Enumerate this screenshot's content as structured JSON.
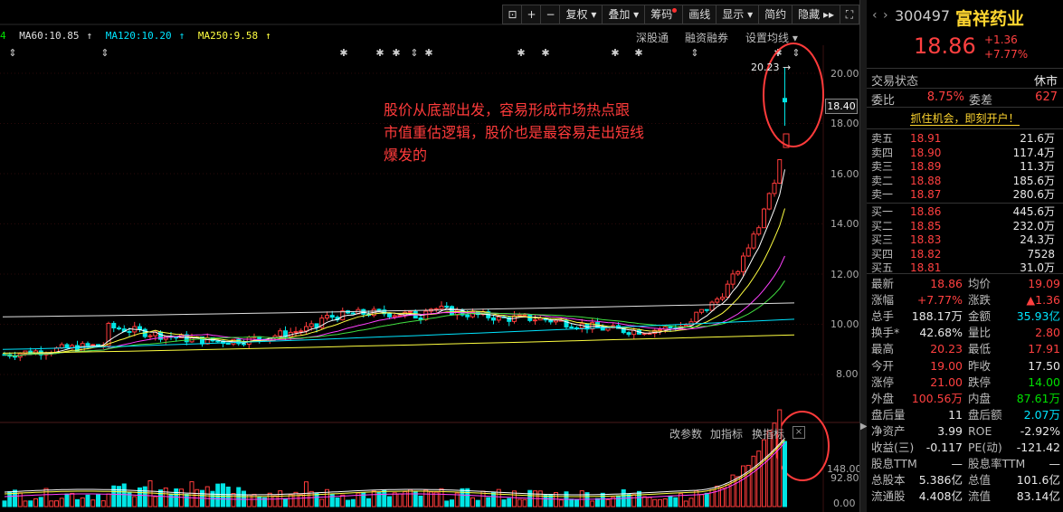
{
  "toolbar": {
    "buttons": [
      "复权",
      "叠加",
      "筹码",
      "画线",
      "显示",
      "简约",
      "隐藏"
    ],
    "icons": [
      "lock-icon",
      "plus-icon",
      "minus-icon"
    ],
    "chip_dot_color": "#ff3030"
  },
  "ma_bar": {
    "items": [
      {
        "label": "4",
        "color": "#00e000"
      },
      {
        "label": "MA60:10.85",
        "color": "#e0e0e0"
      },
      {
        "label": "MA120:10.20",
        "color": "#00e5ff"
      },
      {
        "label": "MA250:9.58",
        "color": "#ffff40"
      }
    ],
    "tools": [
      "深股通",
      "融资融券",
      "设置均线"
    ]
  },
  "annotation": {
    "lines": [
      "股价从底部出发，容易形成市场热点跟",
      "市值重估逻辑，股价也是最容易走出短线",
      "爆发的"
    ]
  },
  "price_axis": {
    "ticks": [
      "20.00",
      "18.00",
      "16.00",
      "14.00",
      "12.00",
      "10.00",
      "8.00"
    ],
    "current": "18.40",
    "high_marker": "20.23"
  },
  "indicator": {
    "tools": [
      "改参数",
      "加指标",
      "换指标"
    ],
    "ticks": [
      "148.00",
      "92.80",
      "0.00"
    ]
  },
  "chart_data": {
    "type": "candlestick",
    "ylim": [
      7,
      21
    ],
    "highlight_last": {
      "open": 19.0,
      "high": 20.23,
      "low": 17.91,
      "close": 18.86
    },
    "ma_lines": [
      {
        "name": "MA60",
        "value": 10.85,
        "color": "#e0e0e0"
      },
      {
        "name": "MA120",
        "value": 10.2,
        "color": "#00e5ff"
      },
      {
        "name": "MA250",
        "value": 9.58,
        "color": "#ffff40"
      }
    ]
  },
  "quote": {
    "code": "300497",
    "name": "富祥药业",
    "price": "18.86",
    "change": "+1.36",
    "pct": "+7.77%",
    "status_label": "交易状态",
    "status": "休市",
    "weibi_label": "委比",
    "weibi": "8.75%",
    "weicha_label": "委差",
    "weicha": "627",
    "promo": "抓住机会，即刻开户！"
  },
  "order_book": {
    "asks": [
      {
        "label": "卖五",
        "price": "18.91",
        "vol": "21.6万"
      },
      {
        "label": "卖四",
        "price": "18.90",
        "vol": "117.4万"
      },
      {
        "label": "卖三",
        "price": "18.89",
        "vol": "11.3万"
      },
      {
        "label": "卖二",
        "price": "18.88",
        "vol": "185.6万"
      },
      {
        "label": "卖一",
        "price": "18.87",
        "vol": "280.6万"
      }
    ],
    "bids": [
      {
        "label": "买一",
        "price": "18.86",
        "vol": "445.6万"
      },
      {
        "label": "买二",
        "price": "18.85",
        "vol": "232.0万"
      },
      {
        "label": "买三",
        "price": "18.83",
        "vol": "24.3万"
      },
      {
        "label": "买四",
        "price": "18.82",
        "vol": "7528"
      },
      {
        "label": "买五",
        "price": "18.81",
        "vol": "31.0万"
      }
    ]
  },
  "stats": [
    {
      "l1": "最新",
      "v1": "18.86",
      "c1": "red",
      "l2": "均价",
      "v2": "19.09",
      "c2": "red"
    },
    {
      "l1": "涨幅",
      "v1": "+7.77%",
      "c1": "red",
      "l2": "涨跌",
      "v2": "▲1.36",
      "c2": "red"
    },
    {
      "l1": "总手",
      "v1": "188.17万",
      "c1": "white",
      "l2": "金额",
      "v2": "35.93亿",
      "c2": "cyan"
    },
    {
      "l1": "换手*",
      "v1": "42.68%",
      "c1": "white",
      "l2": "量比",
      "v2": "2.80",
      "c2": "red"
    },
    {
      "l1": "最高",
      "v1": "20.23",
      "c1": "red",
      "l2": "最低",
      "v2": "17.91",
      "c2": "red"
    },
    {
      "l1": "今开",
      "v1": "19.00",
      "c1": "red",
      "l2": "昨收",
      "v2": "17.50",
      "c2": "white"
    },
    {
      "l1": "涨停",
      "v1": "21.00",
      "c1": "red",
      "l2": "跌停",
      "v2": "14.00",
      "c2": "green"
    },
    {
      "l1": "外盘",
      "v1": "100.56万",
      "c1": "red",
      "l2": "内盘",
      "v2": "87.61万",
      "c2": "green"
    },
    {
      "l1": "盘后量",
      "v1": "11",
      "c1": "white",
      "l2": "盘后额",
      "v2": "2.07万",
      "c2": "cyan"
    },
    {
      "l1": "净资产",
      "v1": "3.99",
      "c1": "white",
      "l2": "ROE",
      "v2": "-2.92%",
      "c2": "white"
    },
    {
      "l1": "收益(三)",
      "v1": "-0.117",
      "c1": "white",
      "l2": "PE(动)",
      "v2": "-121.42",
      "c2": "white"
    },
    {
      "l1": "股息TTM",
      "v1": "—",
      "c1": "white",
      "l2": "股息率TTM",
      "v2": "—",
      "c2": "white"
    },
    {
      "l1": "总股本",
      "v1": "5.386亿",
      "c1": "white",
      "l2": "总值",
      "v2": "101.6亿",
      "c2": "white"
    },
    {
      "l1": "流通股",
      "v1": "4.408亿",
      "c1": "white",
      "l2": "流值",
      "v2": "83.14亿",
      "c2": "white"
    }
  ]
}
